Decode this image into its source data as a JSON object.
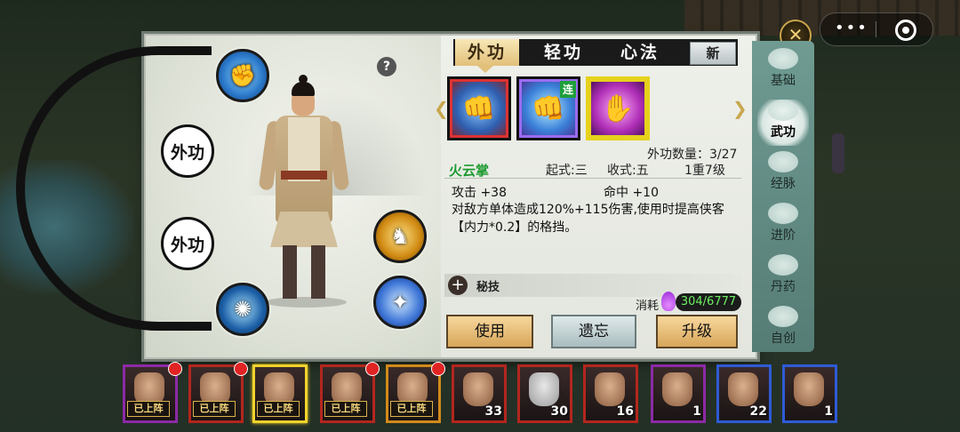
{
  "tabs": [
    "外功",
    "轻功",
    "心法"
  ],
  "new_label": "新",
  "help_label": "?",
  "close_label": "✕",
  "slot_badges": [
    "外功",
    "外功"
  ],
  "skill_count": "外功数量：3/27",
  "skill": {
    "name": "火云掌",
    "start": "起式:三",
    "end": "收式:五",
    "level": "1重7级",
    "attack": "攻击 +38",
    "hit": "命中 +10",
    "description": "对敌方单体造成120%+115伤害,使用时提高侠客【内力*0.2】的格挡。"
  },
  "card2_badge": "连",
  "secret_label": "秘技",
  "cost_label": "消耗",
  "cost_value": "304/6777",
  "buttons": {
    "use": "使用",
    "forget": "遗忘",
    "upgrade": "升级"
  },
  "side_nav": [
    {
      "label": "基础",
      "icon": "basics-icon"
    },
    {
      "label": "武功",
      "icon": "martial-arts-icon"
    },
    {
      "label": "经脉",
      "icon": "meridians-icon"
    },
    {
      "label": "进阶",
      "icon": "advance-icon"
    },
    {
      "label": "丹药",
      "icon": "elixir-icon"
    },
    {
      "label": "自创",
      "icon": "create-icon"
    }
  ],
  "roster": [
    {
      "label": "已上阵",
      "has_dot": true,
      "border": "purple"
    },
    {
      "label": "已上阵",
      "has_dot": true,
      "border": "red"
    },
    {
      "label": "已上阵",
      "has_dot": false,
      "border": "selected"
    },
    {
      "label": "已上阵",
      "has_dot": true,
      "border": "red"
    },
    {
      "label": "已上阵",
      "has_dot": true,
      "border": "gold"
    },
    {
      "label": "33",
      "border": "red"
    },
    {
      "label": "30",
      "border": "red"
    },
    {
      "label": "16",
      "border": "red"
    },
    {
      "label": "1",
      "border": "purple"
    },
    {
      "label": "22",
      "border": "blue"
    },
    {
      "label": "1",
      "border": "blue"
    }
  ]
}
